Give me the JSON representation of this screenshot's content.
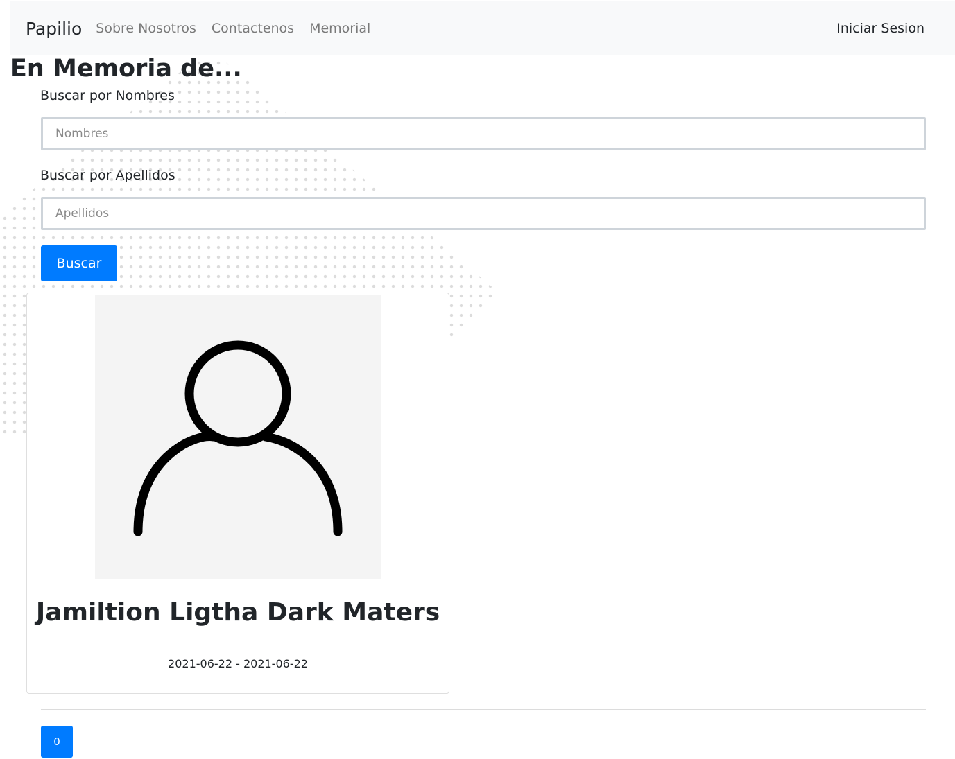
{
  "navbar": {
    "brand": "Papilio",
    "links": [
      "Sobre Nosotros",
      "Contactenos",
      "Memorial"
    ],
    "login": "Iniciar Sesion"
  },
  "page_title": "En Memoria de...",
  "search": {
    "names_label": "Buscar por Nombres",
    "names_placeholder": "Nombres",
    "surnames_label": "Buscar por Apellidos",
    "surnames_placeholder": "Apellidos",
    "button_label": "Buscar"
  },
  "cards": [
    {
      "image_icon": "person-icon",
      "name": "Jamiltion Ligtha Dark Maters",
      "dates": "2021-06-22 - 2021-06-22"
    }
  ],
  "pagination": {
    "pages": [
      "0"
    ]
  },
  "colors": {
    "primary": "#007bff",
    "navbar_bg": "#f8f9fa",
    "card_image_bg": "#f4f4f4"
  }
}
